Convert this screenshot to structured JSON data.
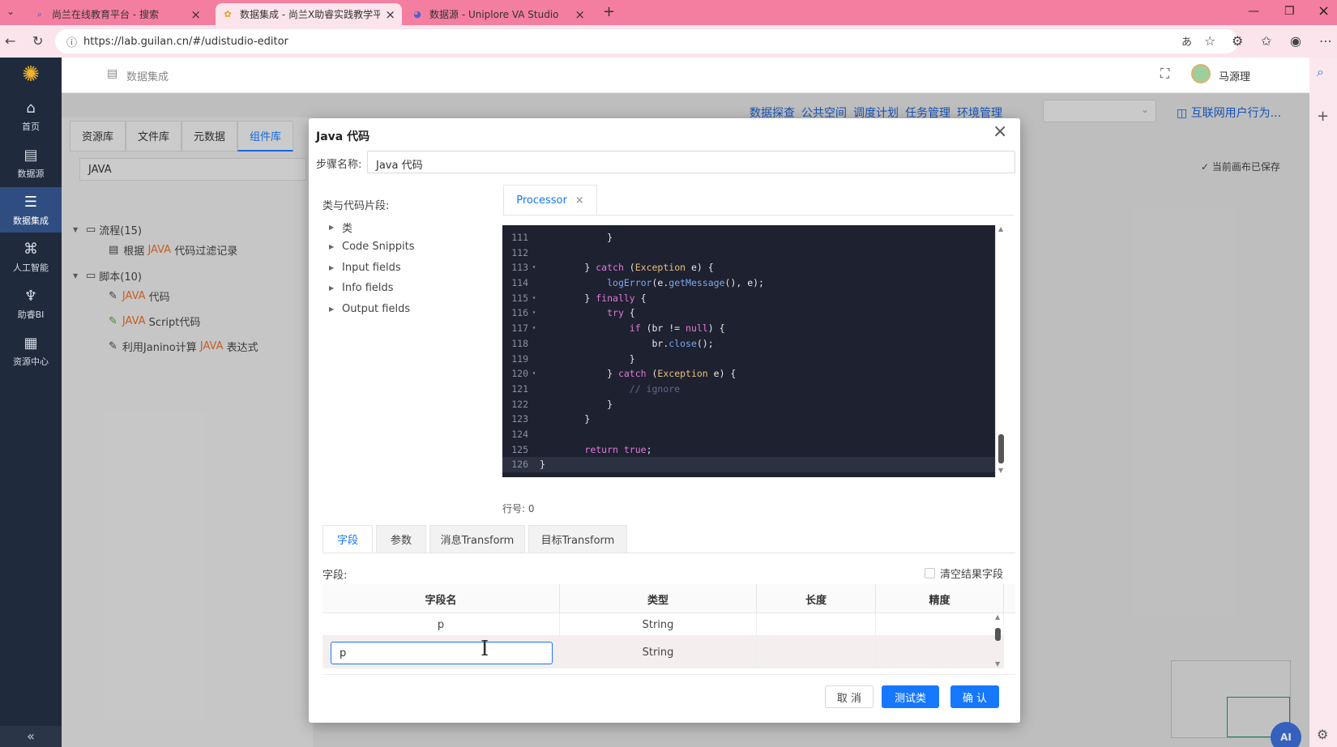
{
  "browser": {
    "tabs": [
      {
        "label": "尚兰在线教育平台 - 搜索",
        "icon": "search-icon"
      },
      {
        "label": "数据集成 - 尚兰X助睿实践教学平台",
        "icon": "app-icon"
      },
      {
        "label": "数据源 - Uniplore VA Studio",
        "icon": "app-icon"
      }
    ],
    "url": "https://lab.guilan.cn/#/udistudio-editor"
  },
  "sidebar": {
    "items": [
      {
        "label": "首页",
        "icon": "home-icon"
      },
      {
        "label": "数据源",
        "icon": "datasource-icon"
      },
      {
        "label": "数据集成",
        "icon": "integration-icon"
      },
      {
        "label": "人工智能",
        "icon": "ai-icon"
      },
      {
        "label": "助睿BI",
        "icon": "bi-icon"
      },
      {
        "label": "资源中心",
        "icon": "resource-icon"
      }
    ],
    "collapse": "«"
  },
  "header": {
    "breadcrumb": "数据集成",
    "user": "马源理"
  },
  "toolbar": {
    "links": [
      "数据探查",
      "公共空间",
      "调度计划",
      "任务管理",
      "环境管理"
    ],
    "project": "互联网用户行为...",
    "saved": "当前画布已保存"
  },
  "library": {
    "tabs": [
      "资源库",
      "文件库",
      "元数据",
      "组件库"
    ],
    "search": "JAVA",
    "tree": [
      {
        "label": "流程(15)",
        "children": [
          {
            "pre": "根据 ",
            "hl": "JAVA",
            "post": " 代码过滤记录"
          }
        ]
      },
      {
        "label": "脚本(10)",
        "children": [
          {
            "pre": "",
            "hl": "JAVA",
            "post": " 代码"
          },
          {
            "pre": "",
            "hl": "JAVA",
            "post": " Script代码"
          },
          {
            "pre": "利用Janino计算 ",
            "hl": "JAVA",
            "post": " 表达式"
          }
        ]
      }
    ]
  },
  "dialog": {
    "title": "Java 代码",
    "step_label": "步骤名称:",
    "step_value": "Java 代码",
    "snippets_title": "类与代码片段:",
    "snippets": [
      "类",
      "Code Snippits",
      "Input fields",
      "Info fields",
      "Output fields"
    ],
    "editor_tab": "Processor",
    "code": [
      {
        "n": "111",
        "f": "",
        "t": [
          [
            "            ",
            "id"
          ],
          [
            "}",
            "id"
          ]
        ]
      },
      {
        "n": "112",
        "f": "",
        "t": []
      },
      {
        "n": "113",
        "f": "▾",
        "t": [
          [
            "        } ",
            "id"
          ],
          [
            "catch",
            "kw"
          ],
          [
            " (",
            "id"
          ],
          [
            "Exception",
            "ty"
          ],
          [
            " e) {",
            "id"
          ]
        ]
      },
      {
        "n": "114",
        "f": "",
        "t": [
          [
            "            ",
            "id"
          ],
          [
            "logError",
            "fn"
          ],
          [
            "(e.",
            "id"
          ],
          [
            "getMessage",
            "fn"
          ],
          [
            "(), e);",
            "id"
          ]
        ]
      },
      {
        "n": "115",
        "f": "▾",
        "t": [
          [
            "        } ",
            "id"
          ],
          [
            "finally",
            "kw"
          ],
          [
            " {",
            "id"
          ]
        ]
      },
      {
        "n": "116",
        "f": "▾",
        "t": [
          [
            "            ",
            "id"
          ],
          [
            "try",
            "kw"
          ],
          [
            " {",
            "id"
          ]
        ]
      },
      {
        "n": "117",
        "f": "▾",
        "t": [
          [
            "                ",
            "id"
          ],
          [
            "if",
            "kw"
          ],
          [
            " (br != ",
            "id"
          ],
          [
            "null",
            "kw"
          ],
          [
            ") {",
            "id"
          ]
        ]
      },
      {
        "n": "118",
        "f": "",
        "t": [
          [
            "                    br.",
            "id"
          ],
          [
            "close",
            "fn"
          ],
          [
            "();",
            "id"
          ]
        ]
      },
      {
        "n": "119",
        "f": "",
        "t": [
          [
            "                }",
            "id"
          ]
        ]
      },
      {
        "n": "120",
        "f": "▾",
        "t": [
          [
            "            } ",
            "id"
          ],
          [
            "catch",
            "kw"
          ],
          [
            " (",
            "id"
          ],
          [
            "Exception",
            "ty"
          ],
          [
            " e) {",
            "id"
          ]
        ]
      },
      {
        "n": "121",
        "f": "",
        "t": [
          [
            "                ",
            "id"
          ],
          [
            "// ignore",
            "cm"
          ]
        ]
      },
      {
        "n": "122",
        "f": "",
        "t": [
          [
            "            }",
            "id"
          ]
        ]
      },
      {
        "n": "123",
        "f": "",
        "t": [
          [
            "        }",
            "id"
          ]
        ]
      },
      {
        "n": "124",
        "f": "",
        "t": []
      },
      {
        "n": "125",
        "f": "",
        "t": [
          [
            "        ",
            "id"
          ],
          [
            "return",
            "kw"
          ],
          [
            " ",
            "id"
          ],
          [
            "true",
            "kw"
          ],
          [
            ";",
            "id"
          ]
        ]
      },
      {
        "n": "126",
        "f": "",
        "t": [
          [
            "}",
            "id"
          ]
        ]
      }
    ],
    "line_info": "行号: 0",
    "subtabs": [
      "字段",
      "参数",
      "消息Transform",
      "目标Transform"
    ],
    "fields_label": "字段:",
    "clear_label": "清空结果字段",
    "columns": [
      "字段名",
      "类型",
      "长度",
      "精度"
    ],
    "rows": [
      {
        "name": "p",
        "type": "String",
        "length": "",
        "precision": ""
      },
      {
        "name": "p",
        "type": "String",
        "length": "",
        "precision": ""
      }
    ],
    "buttons": {
      "cancel": "取 消",
      "test": "测试类",
      "ok": "确 认"
    }
  },
  "colors": {
    "accent": "#1677ff",
    "sidebar_bg": "#1f2a3d",
    "sidebar_active": "#2f4d80",
    "editor_bg": "#1e2130",
    "tabstrip": "#f47ea0"
  }
}
